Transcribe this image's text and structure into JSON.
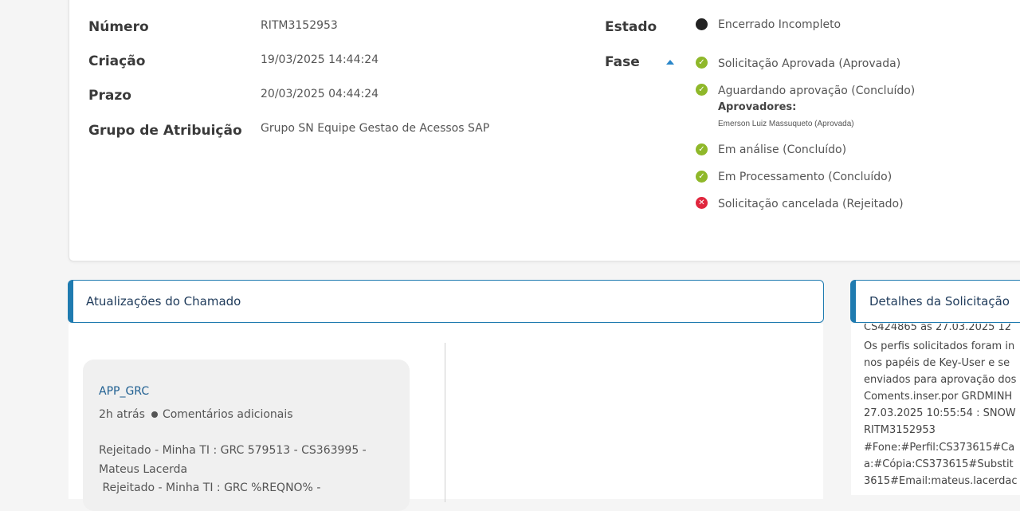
{
  "details": {
    "numero_label": "Número",
    "numero_value": "RITM3152953",
    "criacao_label": "Criação",
    "criacao_value": "19/03/2025 14:44:24",
    "prazo_label": "Prazo",
    "prazo_value": "20/03/2025 04:44:24",
    "grupo_label": "Grupo de Atribuição",
    "grupo_value": "Grupo SN Equipe Gestao de Acessos SAP"
  },
  "status": {
    "estado_label": "Estado",
    "estado_value": "Encerrado Incompleto",
    "fase_label": "Fase",
    "phases": [
      {
        "label": "Solicitação Aprovada (Aprovada)",
        "state": "ok",
        "icon": "check-icon"
      },
      {
        "label": "Aguardando aprovação (Concluído)",
        "state": "ok",
        "icon": "check-icon"
      },
      {
        "label": "Em análise (Concluído)",
        "state": "ok",
        "icon": "check-icon"
      },
      {
        "label": "Em Processamento (Concluído)",
        "state": "ok",
        "icon": "check-icon"
      },
      {
        "label": "Solicitação cancelada (Rejeitado)",
        "state": "rejected",
        "icon": "x-icon"
      }
    ],
    "approvers_label": "Aprovadores:",
    "approvers_value": "Emerson Luiz Massuqueto (Aprovada)"
  },
  "updates": {
    "title": "Atualizações do Chamado",
    "comment": {
      "author": "APP_GRC",
      "time": "2h atrás",
      "type": "Comentários adicionais",
      "lines": [
        "Rejeitado - Minha TI : GRC 579513 - CS363995 -",
        "Mateus Lacerda",
        " Rejeitado - Minha TI : GRC %REQNO% -"
      ]
    }
  },
  "request_details": {
    "title": "Detalhes da Solicitação",
    "lines": [
      "CS424865 às 27.03.2025 12",
      "Os perfis solicitados foram in",
      "nos papéis de Key-User e se",
      "enviados para aprovação dos",
      "Coments.inser.por GRDMINH",
      "27.03.2025 10:55:54 : SNOW",
      "RITM3152953",
      "#Fone:#Perfil:CS373615#Ca",
      "a:#Cópia:CS373615#Substit",
      "3615#Email:mateus.lacerdac"
    ]
  },
  "colors": {
    "accent": "#1f7bb0",
    "ok": "#8fb82a",
    "rejected": "#e0263d"
  }
}
